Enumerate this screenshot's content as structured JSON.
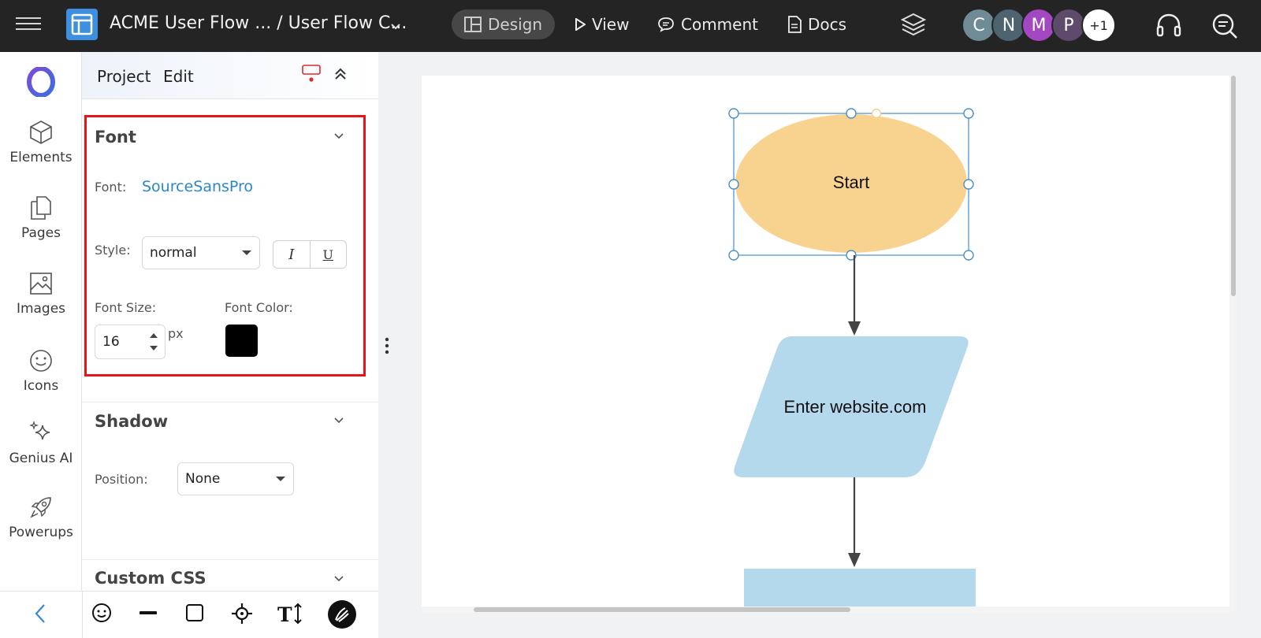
{
  "topbar": {
    "doc_title": "ACME User Flow ... / User Flow C...",
    "tabs": [
      {
        "label": "Design",
        "icon": "layout-icon"
      },
      {
        "label": "View",
        "icon": "play-icon"
      },
      {
        "label": "Comment",
        "icon": "comment-icon"
      },
      {
        "label": "Docs",
        "icon": "document-icon"
      }
    ],
    "avatars": [
      {
        "initial": "C",
        "color": "#6f8c96"
      },
      {
        "initial": "N",
        "color": "#4d6470"
      },
      {
        "initial": "M",
        "color": "#a347c2"
      },
      {
        "initial": "P",
        "color": "#5e4a6a"
      }
    ],
    "extra_users": "+1"
  },
  "leftnav": {
    "items": [
      {
        "label": "Elements",
        "icon": "cube-icon"
      },
      {
        "label": "Pages",
        "icon": "pages-icon"
      },
      {
        "label": "Images",
        "icon": "image-icon"
      },
      {
        "label": "Icons",
        "icon": "smiley-icon"
      },
      {
        "label": "Genius AI",
        "icon": "sparkle-icon"
      },
      {
        "label": "Powerups",
        "icon": "rocket-icon"
      }
    ]
  },
  "panel": {
    "menu": {
      "project": "Project",
      "edit": "Edit"
    },
    "font_section": {
      "title": "Font",
      "font_label": "Font:",
      "font_value": "SourceSansPro",
      "style_label": "Style:",
      "style_value": "normal",
      "italic_glyph": "I",
      "underline_glyph": "U",
      "size_label": "Font Size:",
      "size_value": "16",
      "size_unit": "px",
      "color_label": "Font Color:",
      "color_value": "#000000"
    },
    "shadow_section": {
      "title": "Shadow",
      "position_label": "Position:",
      "position_value": "None"
    },
    "css_section": {
      "title": "Custom CSS"
    }
  },
  "canvas": {
    "shapes": [
      {
        "type": "ellipse",
        "label": "Start",
        "fill": "#f8d38f",
        "selected": true
      },
      {
        "type": "parallelogram",
        "label": "Enter website.com",
        "fill": "#b4d8ec"
      },
      {
        "type": "rectangle",
        "label": "",
        "fill": "#b4d8ec"
      }
    ],
    "selection_color": "#4a90c8"
  }
}
